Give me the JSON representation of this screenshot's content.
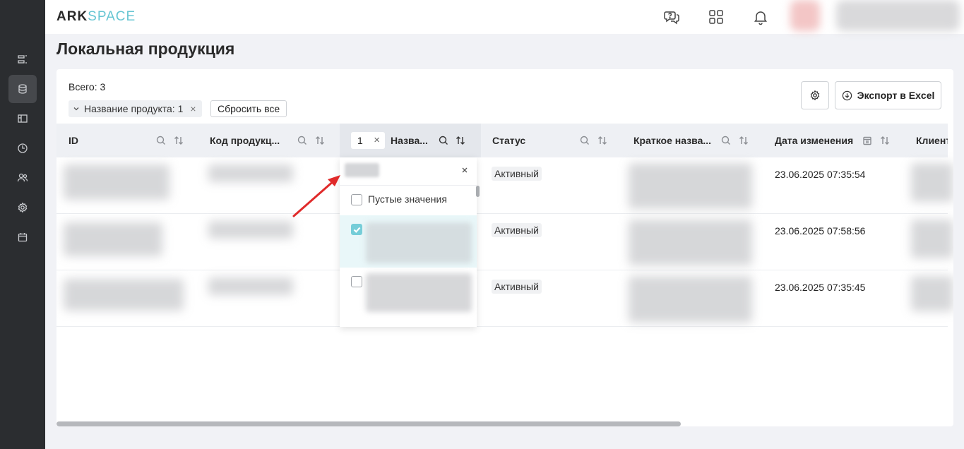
{
  "header": {
    "logo_part1": "ARK",
    "logo_part2": "SPACE",
    "icons": [
      "chat-help-icon",
      "apps-grid-icon",
      "bell-icon"
    ]
  },
  "sidebar": {
    "items": [
      {
        "icon": "list-icon",
        "active": false
      },
      {
        "icon": "database-icon",
        "active": true
      },
      {
        "icon": "layout-icon",
        "active": false
      },
      {
        "icon": "clock-icon",
        "active": false
      },
      {
        "icon": "users-icon",
        "active": false
      },
      {
        "icon": "settings-icon",
        "active": false
      },
      {
        "icon": "calendar-icon",
        "active": false
      }
    ]
  },
  "page": {
    "title": "Локальная продукция"
  },
  "toolbar": {
    "total": "Всего: 3",
    "filter_chip": "Название продукта: 1",
    "reset_label": "Сбросить все",
    "export_label": "Экспорт в Excel"
  },
  "table": {
    "columns": [
      {
        "label": "ID"
      },
      {
        "label": "Код продукц..."
      },
      {
        "label": "Назва...",
        "filter_count": "1"
      },
      {
        "label": "Статус"
      },
      {
        "label": "Краткое назва..."
      },
      {
        "label": "Дата изменения"
      },
      {
        "label": "Клиент"
      }
    ],
    "rows": [
      {
        "status": "Активный",
        "date": "23.06.2025 07:35:54"
      },
      {
        "status": "Активный",
        "date": "23.06.2025 07:58:56"
      },
      {
        "status": "Активный",
        "date": "23.06.2025 07:35:45"
      }
    ]
  },
  "dropdown": {
    "empty_option": "Пустые значения",
    "options": [
      {
        "checked": false
      },
      {
        "checked": true
      },
      {
        "checked": false
      }
    ]
  },
  "colors": {
    "accent": "#75cdd8",
    "sidebar": "#2b2d30",
    "arrow": "#e02a2a"
  }
}
